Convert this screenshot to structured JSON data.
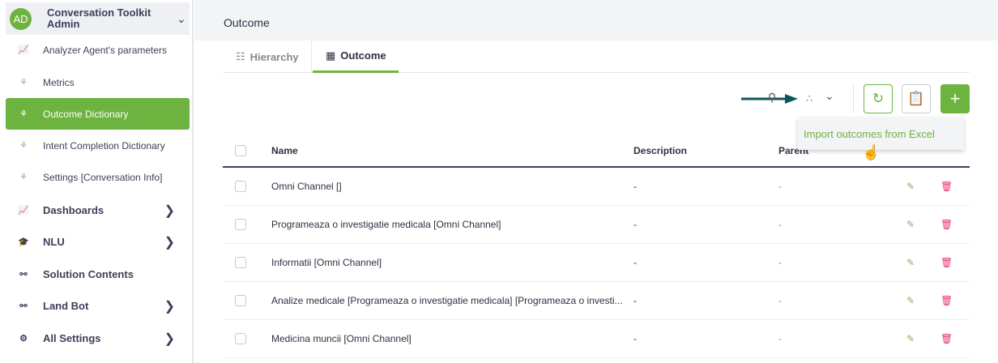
{
  "sidebar": {
    "avatar": "AD",
    "title": "Conversation Toolkit Admin",
    "items": [
      {
        "label": "Analyzer Agent's parameters"
      },
      {
        "label": "Metrics"
      },
      {
        "label": "Outcome Dictionary"
      },
      {
        "label": "Intent Completion Dictionary"
      },
      {
        "label": "Settings [Conversation Info]"
      },
      {
        "label": "Dashboards"
      },
      {
        "label": "NLU"
      },
      {
        "label": "Solution Contents"
      },
      {
        "label": "Land Bot"
      },
      {
        "label": "All Settings"
      }
    ]
  },
  "header": {
    "title": "Outcome"
  },
  "tabs": [
    {
      "label": "Hierarchy"
    },
    {
      "label": "Outcome"
    }
  ],
  "dropdown": {
    "item": "Import outcomes from Excel"
  },
  "table": {
    "headers": {
      "name": "Name",
      "description": "Description",
      "parent": "Parent"
    },
    "rows": [
      {
        "name": "Omni Channel []",
        "description": "-",
        "parent": "-"
      },
      {
        "name": "Programeaza o investigatie medicala [Omni Channel]",
        "description": "-",
        "parent": "-"
      },
      {
        "name": "Informatii [Omni Channel]",
        "description": "-",
        "parent": "-"
      },
      {
        "name": "Analize medicale [Programeaza o investigatie medicala] [Programeaza o investi...",
        "description": "-",
        "parent": "-"
      },
      {
        "name": "Medicina muncii [Omni Channel]",
        "description": "-",
        "parent": "-"
      }
    ]
  },
  "colors": {
    "accent": "#6db33f",
    "delete": "#e8336b"
  }
}
